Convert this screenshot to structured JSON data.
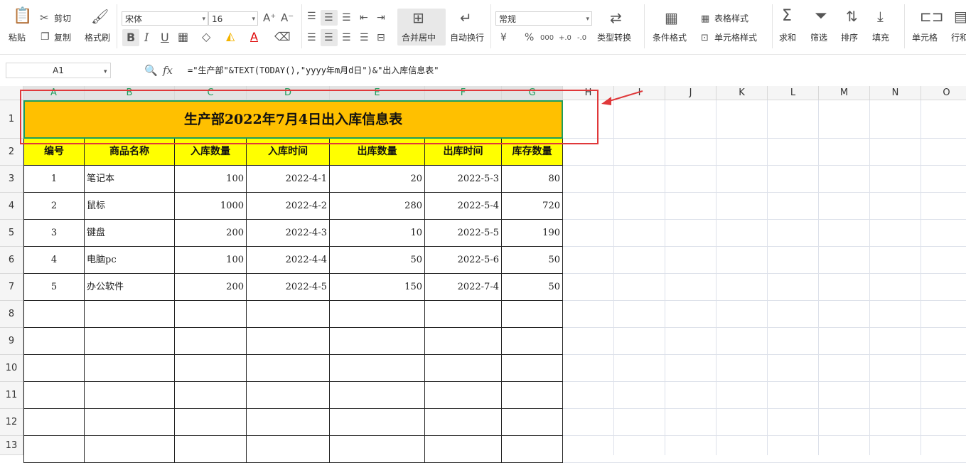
{
  "toolbar": {
    "paste": "粘贴",
    "cut": "剪切",
    "copy": "复制",
    "format_painter": "格式刷",
    "font_name": "宋体",
    "font_size": "16",
    "font_grow": "A⁺",
    "font_shrink": "A⁻",
    "bold": "B",
    "italic": "I",
    "underline": "U",
    "merge_center": "合并居中",
    "wrap_text": "自动换行",
    "number_format": "常规",
    "currency": "¥",
    "percent": "%",
    "thousands": "000",
    "dec_inc": "+.0",
    "dec_dec": "-.0",
    "type_convert": "类型转换",
    "conditional_format": "条件格式",
    "table_style": "表格样式",
    "cell_style": "单元格样式",
    "sum": "求和",
    "filter": "筛选",
    "sort": "排序",
    "fill": "填充",
    "cell": "单元格",
    "row_col": "行和"
  },
  "formula_bar": {
    "name_box": "A1",
    "fx_label": "fx",
    "formula": "=\"生产部\"&TEXT(TODAY(),\"yyyy年m月d日\")&\"出入库信息表\""
  },
  "columns": [
    "A",
    "B",
    "C",
    "D",
    "E",
    "F",
    "G",
    "H",
    "I",
    "J",
    "K",
    "L",
    "M",
    "N",
    "O"
  ],
  "rows": [
    "1",
    "2",
    "3",
    "4",
    "5",
    "6",
    "7",
    "8",
    "9",
    "10",
    "11",
    "12",
    "13"
  ],
  "sheet": {
    "title": "生产部2022年7月4日出入库信息表",
    "headers": [
      "编号",
      "商品名称",
      "入库数量",
      "入库时间",
      "出库数量",
      "出库时间",
      "库存数量"
    ],
    "data": [
      [
        "1",
        "笔记本",
        "100",
        "2022-4-1",
        "20",
        "2022-5-3",
        "80"
      ],
      [
        "2",
        "鼠标",
        "1000",
        "2022-4-2",
        "280",
        "2022-5-4",
        "720"
      ],
      [
        "3",
        "键盘",
        "200",
        "2022-4-3",
        "10",
        "2022-5-5",
        "190"
      ],
      [
        "4",
        "电脑pc",
        "100",
        "2022-4-4",
        "50",
        "2022-5-6",
        "50"
      ],
      [
        "5",
        "办公软件",
        "200",
        "2022-4-5",
        "150",
        "2022-7-4",
        "50"
      ]
    ]
  },
  "colors": {
    "title_fill": "#ffc000",
    "header_fill": "#ffff00",
    "selection": "#1d9e5c",
    "annotation": "#e0383a"
  }
}
